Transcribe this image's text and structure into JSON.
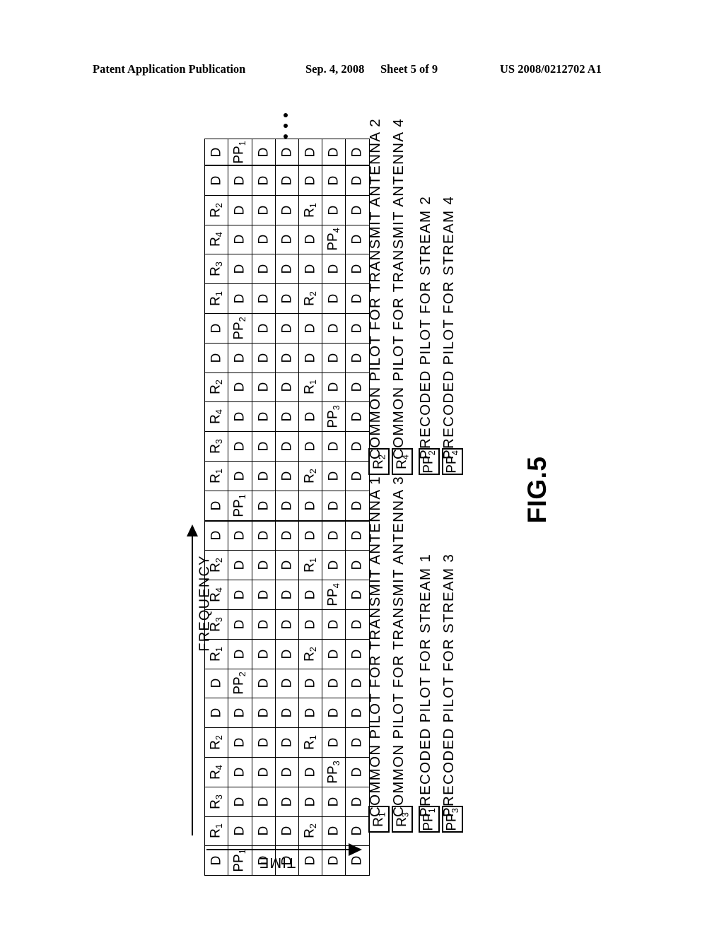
{
  "header": {
    "title": "Patent Application Publication",
    "date": "Sep. 4, 2008",
    "sheet": "Sheet 5 of 9",
    "patent_number": "US 2008/0212702 A1"
  },
  "figure": {
    "label": "FIG.5",
    "axis_frequency": "FREQUENCY",
    "axis_time": "TIME",
    "ellipsis": "vertical-ellipsis"
  },
  "grid": {
    "columns": 7,
    "rows_per_block": 12,
    "blocks": 2,
    "default_cell": "D",
    "block_pattern": [
      [
        "D",
        "PP1",
        "D",
        "D",
        "D",
        "D",
        "D"
      ],
      [
        "R1",
        "D",
        "D",
        "D",
        "R2",
        "D",
        "D"
      ],
      [
        "R3",
        "D",
        "D",
        "D",
        "D",
        "D",
        "D"
      ],
      [
        "R4",
        "D",
        "D",
        "D",
        "D",
        "PP3",
        "D"
      ],
      [
        "R2",
        "D",
        "D",
        "D",
        "R1",
        "D",
        "D"
      ],
      [
        "D",
        "D",
        "D",
        "D",
        "D",
        "D",
        "D"
      ],
      [
        "D",
        "PP2",
        "D",
        "D",
        "D",
        "D",
        "D"
      ],
      [
        "R1",
        "D",
        "D",
        "D",
        "R2",
        "D",
        "D"
      ],
      [
        "R3",
        "D",
        "D",
        "D",
        "D",
        "D",
        "D"
      ],
      [
        "R4",
        "D",
        "D",
        "D",
        "D",
        "PP4",
        "D"
      ],
      [
        "R2",
        "D",
        "D",
        "D",
        "R1",
        "D",
        "D"
      ],
      [
        "D",
        "D",
        "D",
        "D",
        "D",
        "D",
        "D"
      ]
    ],
    "partial_top_row": [
      "D",
      "PP1",
      "D",
      "D",
      "D",
      "D",
      "D"
    ]
  },
  "legend": {
    "group_lower": [
      {
        "symbol": "R1",
        "text": "COMMON PILOT FOR TRANSMIT ANTENNA 1"
      },
      {
        "symbol": "R3",
        "text": "COMMON PILOT FOR TRANSMIT ANTENNA 3"
      },
      {
        "symbol": "PP1",
        "text": "PRECODED PILOT FOR STREAM 1"
      },
      {
        "symbol": "PP3",
        "text": "PRECODED PILOT FOR STREAM 3"
      }
    ],
    "group_upper": [
      {
        "symbol": "R2",
        "text": "COMMON PILOT FOR TRANSMIT ANTENNA 2"
      },
      {
        "symbol": "R4",
        "text": "COMMON PILOT FOR TRANSMIT ANTENNA 4"
      },
      {
        "symbol": "PP2",
        "text": "PRECODED PILOT FOR STREAM 2"
      },
      {
        "symbol": "PP4",
        "text": "PRECODED PILOT FOR STREAM 4"
      }
    ]
  },
  "colors": {
    "ink": "#000000",
    "paper": "#ffffff"
  }
}
